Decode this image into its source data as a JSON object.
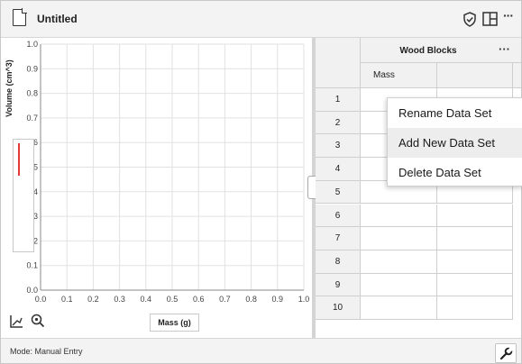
{
  "window": {
    "title": "Untitled"
  },
  "icons": {
    "document": "document-icon",
    "shield": "shield-check-icon",
    "layout": "layout-icon",
    "more": "more-icon",
    "graph_tool": "graph-tool-icon",
    "zoom": "zoom-icon",
    "wrench": "wrench-icon"
  },
  "titlebar": {
    "more_label": "···"
  },
  "graph": {
    "ylabel": "Volume (cm^3)",
    "xlabel": "Mass (g)",
    "ylabel_color": "#e53935"
  },
  "chart_data": {
    "type": "scatter",
    "title": "",
    "xlabel": "Mass (g)",
    "ylabel": "Volume (cm^3)",
    "xlim": [
      0.0,
      1.0
    ],
    "ylim": [
      0.0,
      1.0
    ],
    "x_ticks": [
      "0.0",
      "0.1",
      "0.2",
      "0.3",
      "0.4",
      "0.5",
      "0.6",
      "0.7",
      "0.8",
      "0.9",
      "1.0"
    ],
    "y_ticks": [
      "0.0",
      "0.1",
      "0.2",
      "0.3",
      "0.4",
      "0.5",
      "0.6",
      "0.7",
      "0.8",
      "0.9",
      "1.0"
    ],
    "grid": true,
    "series": []
  },
  "table": {
    "dataset_title": "Wood Blocks",
    "dataset_menu_label": "···",
    "columns": [
      "Mass",
      ""
    ],
    "rows": [
      "1",
      "2",
      "3",
      "4",
      "5",
      "6",
      "7",
      "8",
      "9",
      "10"
    ]
  },
  "context_menu": {
    "items": [
      "Rename Data Set",
      "Add New Data Set",
      "Delete Data Set"
    ],
    "highlighted_item": "Add New Data Set"
  },
  "statusbar": {
    "mode": "Mode: Manual Entry"
  }
}
